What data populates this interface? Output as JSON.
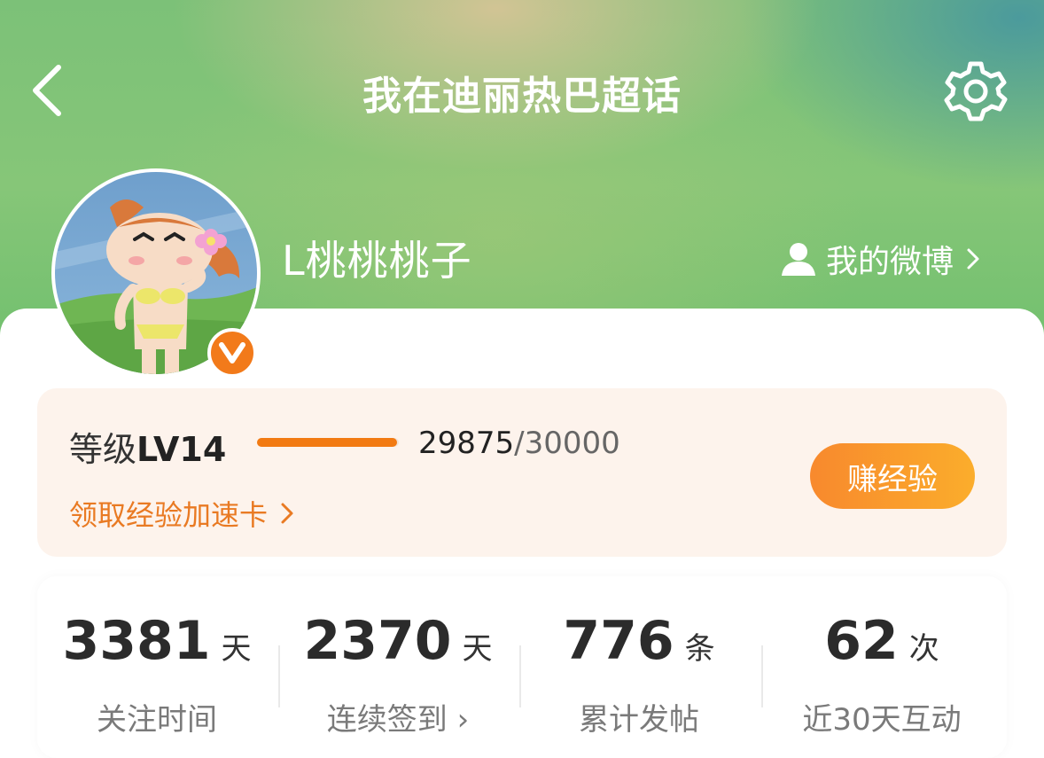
{
  "header": {
    "title": "我在迪丽热巴超话",
    "back_icon": "chevron-left-icon",
    "settings_icon": "gear-icon"
  },
  "profile": {
    "username": "L桃桃桃子",
    "avatar": "cartoon-avatar",
    "verified_badge": "V",
    "my_weibo_label": "我的微博"
  },
  "level": {
    "label": "等级",
    "level": "LV14",
    "current_exp": "29875",
    "total_exp": "/30000",
    "progress": 0.99,
    "boost_link": "领取经验加速卡",
    "earn_button": "赚经验",
    "accent_color": "#f27a12"
  },
  "stats": [
    {
      "value": "3381",
      "unit": "天",
      "label": "关注时间"
    },
    {
      "value": "2370",
      "unit": "天",
      "label": "连续签到 ›"
    },
    {
      "value": "776",
      "unit": "条",
      "label": "累计发帖"
    },
    {
      "value": "62",
      "unit": "次",
      "label": "近30天互动"
    }
  ]
}
